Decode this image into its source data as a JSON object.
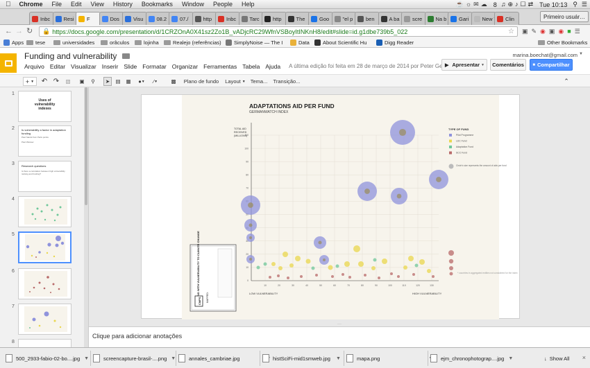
{
  "mac": {
    "app": "Chrome",
    "menus": [
      "File",
      "Edit",
      "View",
      "History",
      "Bookmarks",
      "Window",
      "People",
      "Help"
    ],
    "battery_count": "8",
    "clock": "Tue 10:13"
  },
  "tabs": [
    "Inbc",
    "Resi",
    "F",
    "Dos",
    "Visu",
    "08.2",
    "07./",
    "http",
    "Inbc",
    "Tarc",
    "http",
    "The",
    "Goo",
    "\"el p",
    "ben",
    "A ba",
    "scre",
    "Na b",
    "Gari",
    "New Ta",
    "Clin"
  ],
  "profile_button": "Primeiro usuár…",
  "url": "https://docs.google.com/presentation/d/1CRZOnA0X41sz2Zo1B_vADjcRC29WfnVSBoyItINKnH8/edit#slide=id.g1dbe739b5_022",
  "bookmarks": [
    "Apps",
    "tese",
    "universidades",
    "orâculos",
    "lojinha",
    "Realejo (referências)",
    "SimplyNoise — The I",
    "Data",
    "About Scientific Hu",
    "Digg Reader",
    "Other Bookmarks"
  ],
  "doc": {
    "title": "Funding and vulnerability",
    "account": "marina.boechat@gmail.com",
    "menus": [
      "Arquivo",
      "Editar",
      "Visualizar",
      "Inserir",
      "Slide",
      "Formatar",
      "Organizar",
      "Ferramentas",
      "Tabela",
      "Ajuda"
    ],
    "last_edit": "A última edição foi feita em 28 de março de 2014 por Peter Gerry",
    "present": "Apresentar",
    "comments": "Comentários",
    "share": "Compartilhar"
  },
  "toolbar": {
    "background": "Plano de fundo",
    "layout": "Layout",
    "theme": "Tema...",
    "transition": "Transição..."
  },
  "thumbs": [
    {
      "num": "1",
      "title": "Uses of vulnerability indexes"
    },
    {
      "num": "2",
      "title": "Is vulnerability a factor in adaptation funding",
      "sub1": "Paul Sands from Parts points",
      "sub2": "Paul Weisser"
    },
    {
      "num": "3",
      "title": "Research questions",
      "sub1": "Is there a correlation between high vulnerability ranking and funding?"
    },
    {
      "num": "4"
    },
    {
      "num": "5"
    },
    {
      "num": "6"
    },
    {
      "num": "7"
    },
    {
      "num": "8"
    }
  ],
  "infographic": {
    "title": "ADAPTATIONS AID PER FUND",
    "subtitle": "GERMANWATCH INDEX",
    "ylabel_lines": [
      "TOTAL AID",
      "RECEIVED",
      "(MILLIONS)"
    ],
    "yticks": [
      "110",
      "100",
      "90",
      "80",
      "70",
      "60",
      "50",
      "40",
      "30",
      "20",
      "10",
      "0"
    ],
    "xticks": [
      "10",
      "20",
      "30",
      "40",
      "50",
      "60",
      "70",
      "80",
      "90",
      "100",
      "110",
      "120",
      "130"
    ],
    "x_left": "LOW VULNERABILITY",
    "x_right": "HIGH VULNERABILITY",
    "legend_title": "TYPE OF FUND",
    "legend": [
      {
        "label": "Pilot Programme",
        "color": "#8f93dc"
      },
      {
        "label": "LDC Fund",
        "color": "#e9d74d"
      },
      {
        "label": "Adaptation Fund",
        "color": "#6fc79a"
      },
      {
        "label": "SCC Fund",
        "color": "#b86a6a"
      }
    ],
    "size_note": "Circle's size represents the amount of aids per fund",
    "agg_note": "* countries in aggregated entities not considered for the index",
    "book_title": "COPING WITH VULNERABILITY TO CLIMATE CHANGE",
    "book_mapped": "MAPPED:",
    "book_logo": "CMPS"
  },
  "notes_placeholder": "Clique para adicionar anotações",
  "downloads": [
    "500_2933-fabio-02-bo....jpg",
    "screencapture-brasil-....png",
    "annales_cambriae.jpg",
    "histSciFi-mid1smweb.jpg",
    "mapa.png",
    "ejm_chronophotograp....jpg"
  ],
  "show_all": "Show All"
}
